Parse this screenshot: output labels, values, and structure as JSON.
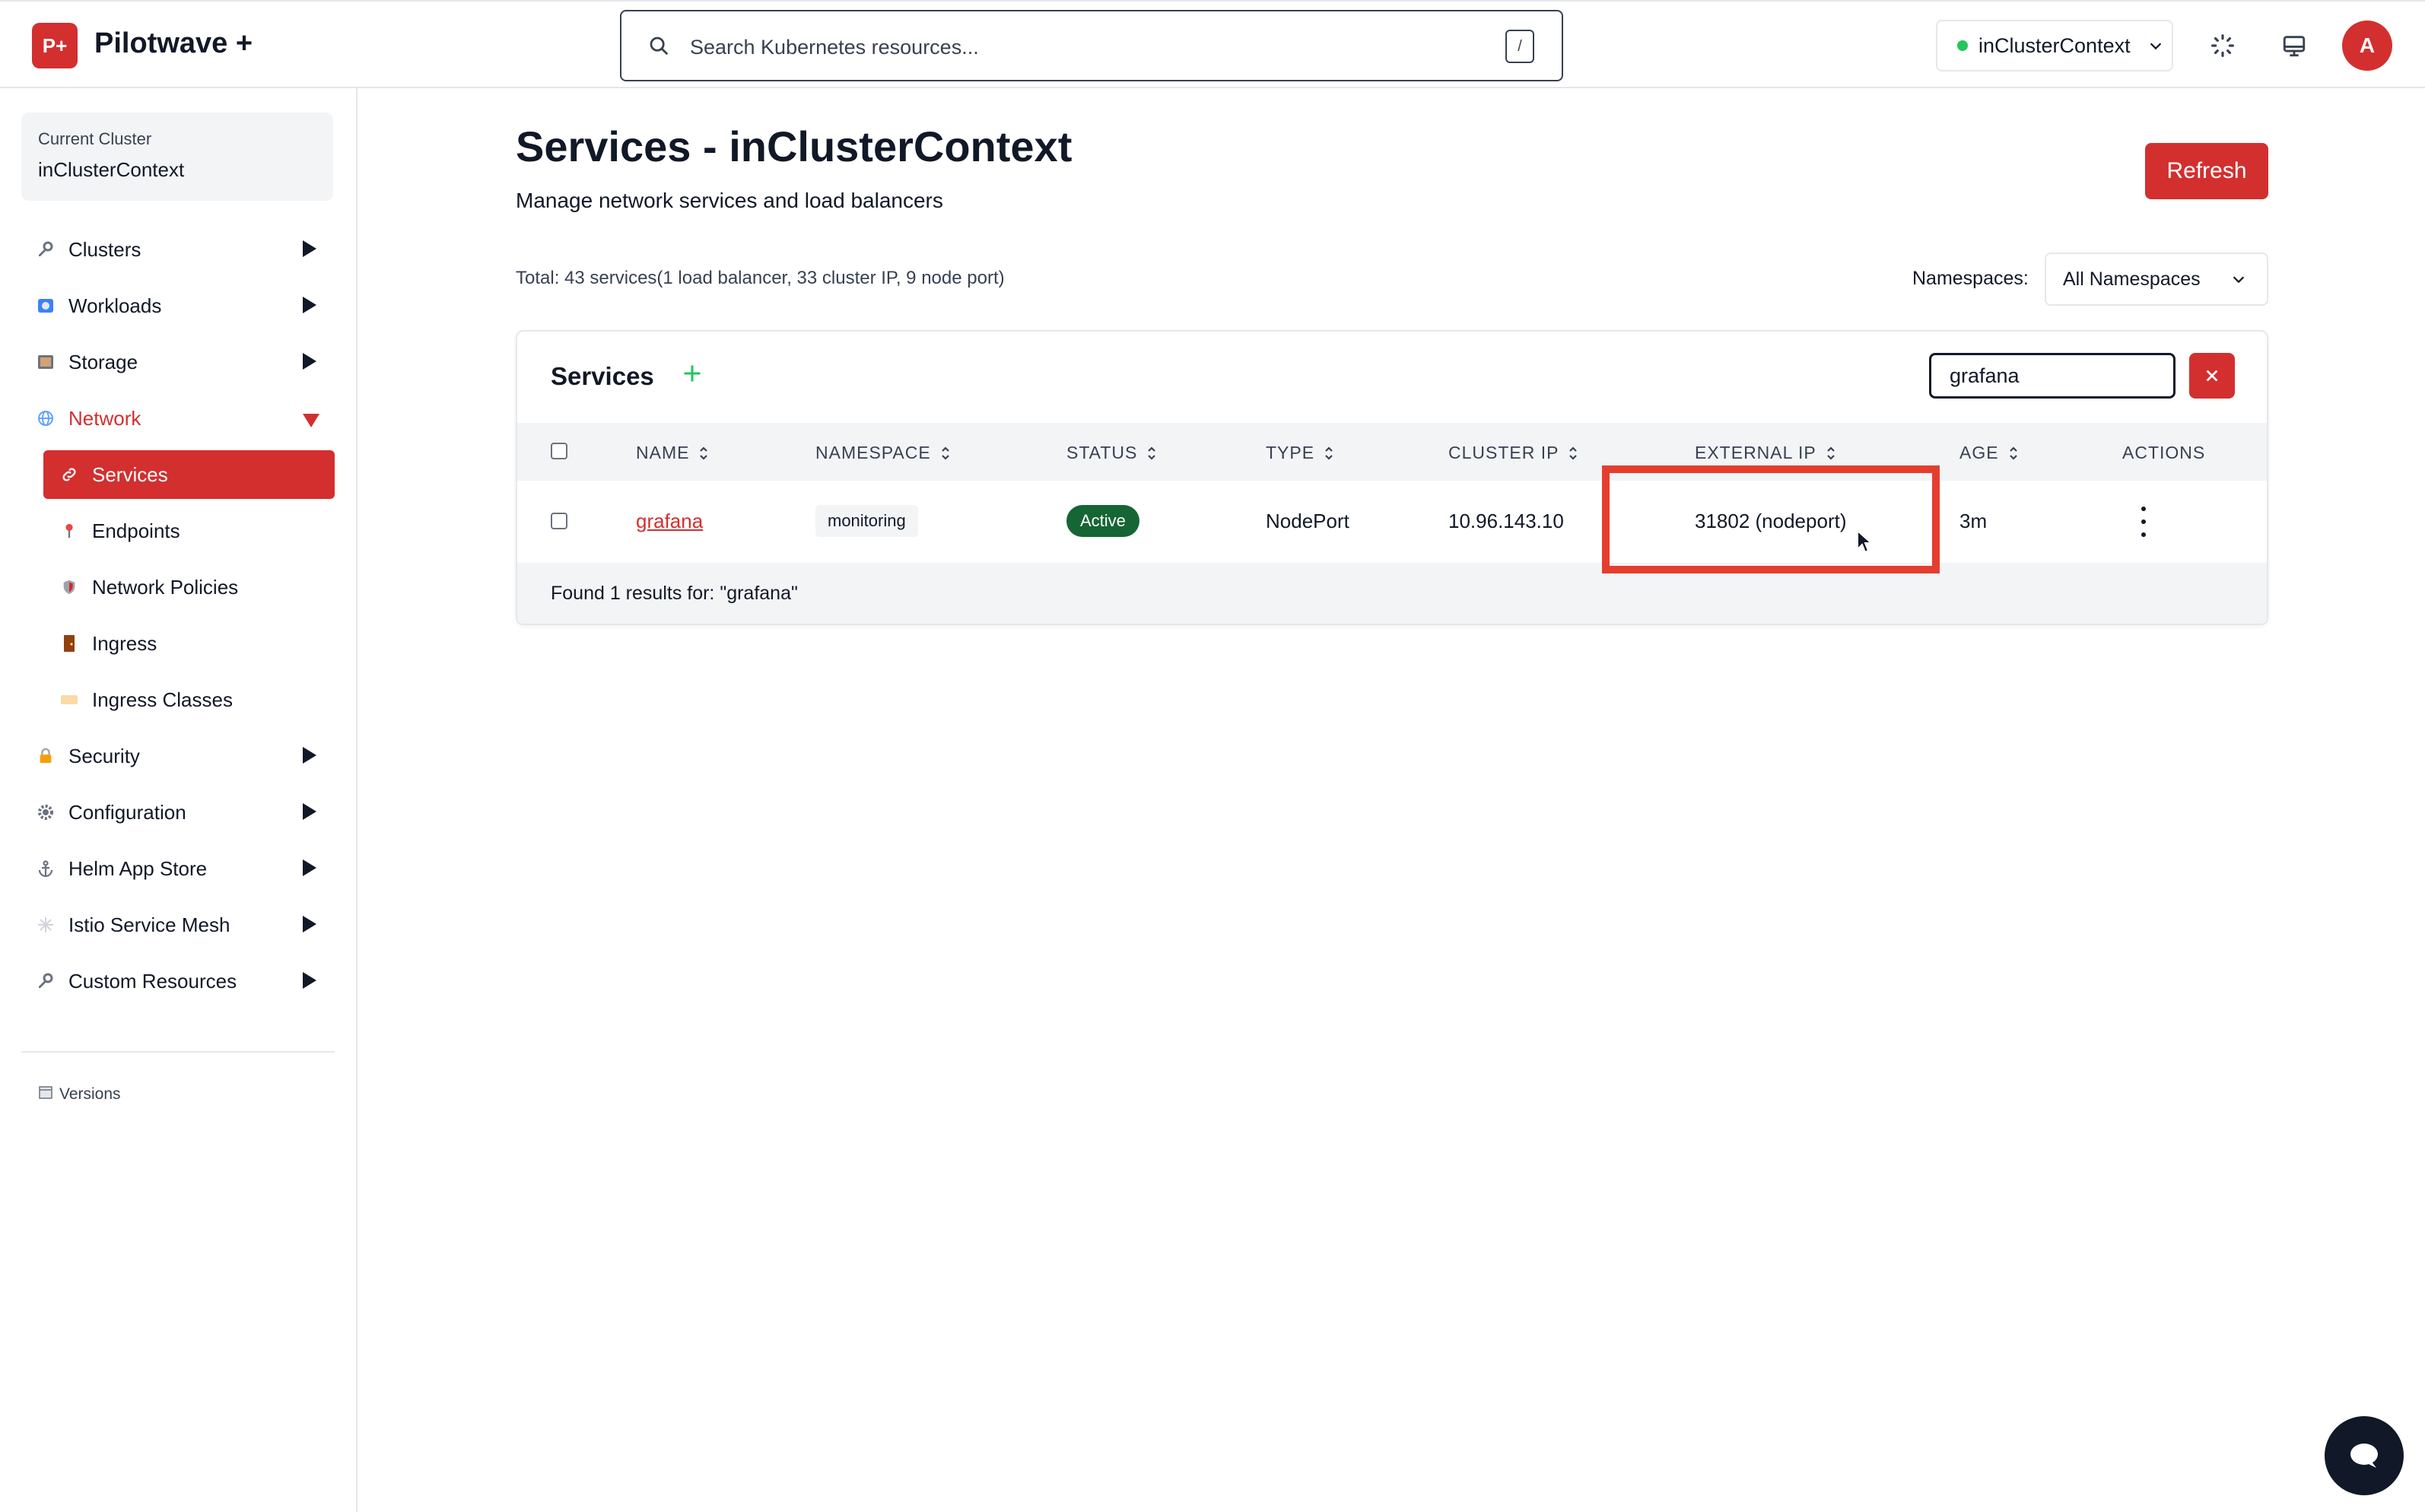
{
  "app": {
    "logo_text": "P+",
    "name": "Pilotwave +"
  },
  "search": {
    "placeholder": "Search Kubernetes resources...",
    "shortcut": "/"
  },
  "context_select": {
    "value": "inClusterContext",
    "status_color": "#22c55e"
  },
  "user": {
    "avatar_letter": "A"
  },
  "sidebar": {
    "current_cluster_label": "Current Cluster",
    "current_cluster_value": "inClusterContext",
    "items": [
      {
        "label": "Clusters",
        "icon": "wrench-icon"
      },
      {
        "label": "Workloads",
        "icon": "workloads-icon"
      },
      {
        "label": "Storage",
        "icon": "storage-icon"
      },
      {
        "label": "Network",
        "icon": "globe-icon",
        "expanded": true
      },
      {
        "label": "Security",
        "icon": "lock-icon"
      },
      {
        "label": "Configuration",
        "icon": "gear-icon"
      },
      {
        "label": "Helm App Store",
        "icon": "anchor-icon"
      },
      {
        "label": "Istio Service Mesh",
        "icon": "mesh-icon"
      },
      {
        "label": "Custom Resources",
        "icon": "wrench-icon"
      }
    ],
    "network_children": [
      {
        "label": "Services",
        "icon": "link-icon",
        "active": true
      },
      {
        "label": "Endpoints",
        "icon": "pin-icon"
      },
      {
        "label": "Network Policies",
        "icon": "shield-icon"
      },
      {
        "label": "Ingress",
        "icon": "door-icon"
      },
      {
        "label": "Ingress Classes",
        "icon": "ticket-icon"
      }
    ],
    "versions_label": "Versions"
  },
  "page": {
    "title": "Services - inClusterContext",
    "subtitle": "Manage network services and load balancers",
    "refresh_label": "Refresh",
    "total_text": "Total: 43 services(1 load balancer, 33 cluster IP, 9 node port)",
    "namespaces_label": "Namespaces:",
    "namespaces_value": "All Namespaces"
  },
  "services_table": {
    "title": "Services",
    "filter_value": "grafana",
    "columns": [
      "NAME",
      "NAMESPACE",
      "STATUS",
      "TYPE",
      "CLUSTER IP",
      "EXTERNAL IP",
      "AGE",
      "ACTIONS"
    ],
    "rows": [
      {
        "name": "grafana",
        "namespace": "monitoring",
        "status": "Active",
        "type": "NodePort",
        "cluster_ip": "10.96.143.10",
        "external_ip": "31802 (nodeport)",
        "age": "3m"
      }
    ],
    "footer": "Found 1 results for: \"grafana\""
  },
  "colors": {
    "accent": "#d32f2f",
    "status_active": "#166534",
    "highlight": "#e53e2f"
  }
}
